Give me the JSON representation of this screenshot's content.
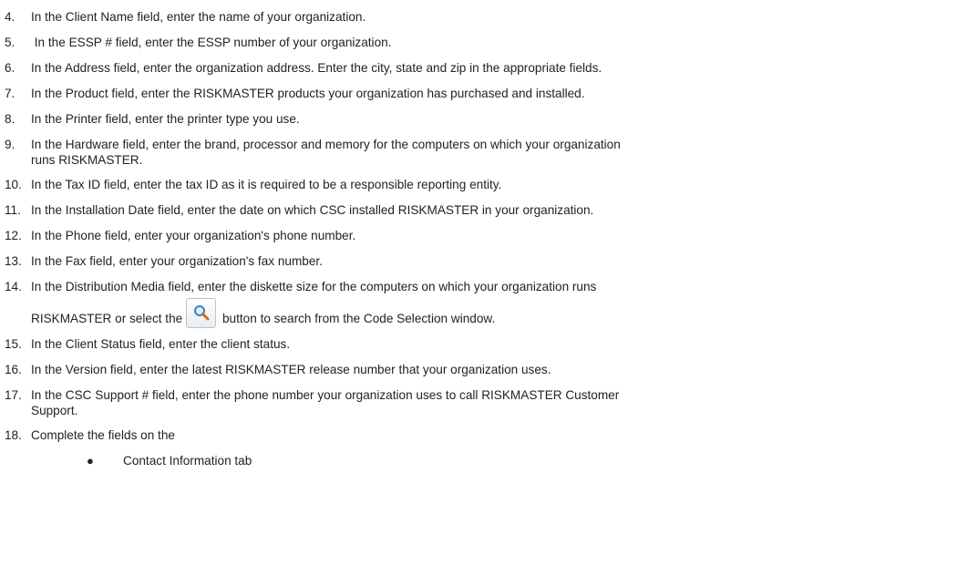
{
  "steps": [
    {
      "number": "4.",
      "text": "In the Client Name field, enter the name of your organization."
    },
    {
      "number": "5.",
      "text": " In the ESSP # field, enter the ESSP number of your organization."
    },
    {
      "number": "6.",
      "text": "In the Address field, enter the organization address. Enter the city, state and zip in the appropriate fields."
    },
    {
      "number": "7.",
      "text": "In the Product field, enter the RISKMASTER products your organization has purchased and installed."
    },
    {
      "number": "8.",
      "text": "In the Printer field, enter the printer type you use."
    },
    {
      "number": "9.",
      "text_line1": "In the Hardware field, enter the brand, processor and memory for the computers on which your organization",
      "text_line2": "runs RISKMASTER."
    },
    {
      "number": "10.",
      "text": "In the Tax ID field, enter the tax ID as it is required to be a responsible reporting entity."
    },
    {
      "number": "11.",
      "text": "In the Installation Date field, enter the date on which CSC installed RISKMASTER in your organization."
    },
    {
      "number": "12.",
      "text": "In the Phone field, enter your organization's phone number."
    },
    {
      "number": "13.",
      "text": "In the Fax field, enter your organization's fax number."
    },
    {
      "number": "14.",
      "text_line1": "In the Distribution Media field, enter the diskette size for the computers on which your organization runs",
      "text_before_button": "RISKMASTER or select the",
      "text_after_button": "button to search from the Code Selection window.",
      "button_icon": "magnifier-search-icon"
    },
    {
      "number": "15.",
      "text": "In the Client Status field, enter the client status."
    },
    {
      "number": "16.",
      "text": "In the Version field, enter the latest RISKMASTER release number that your organization uses."
    },
    {
      "number": "17.",
      "text_line1": "In the CSC Support # field, enter the phone number your organization uses to call RISKMASTER Customer",
      "text_line2": "Support."
    },
    {
      "number": "18.",
      "text": "Complete the fields on the"
    }
  ],
  "bullets": [
    {
      "symbol": "●",
      "text": "Contact Information tab"
    }
  ]
}
